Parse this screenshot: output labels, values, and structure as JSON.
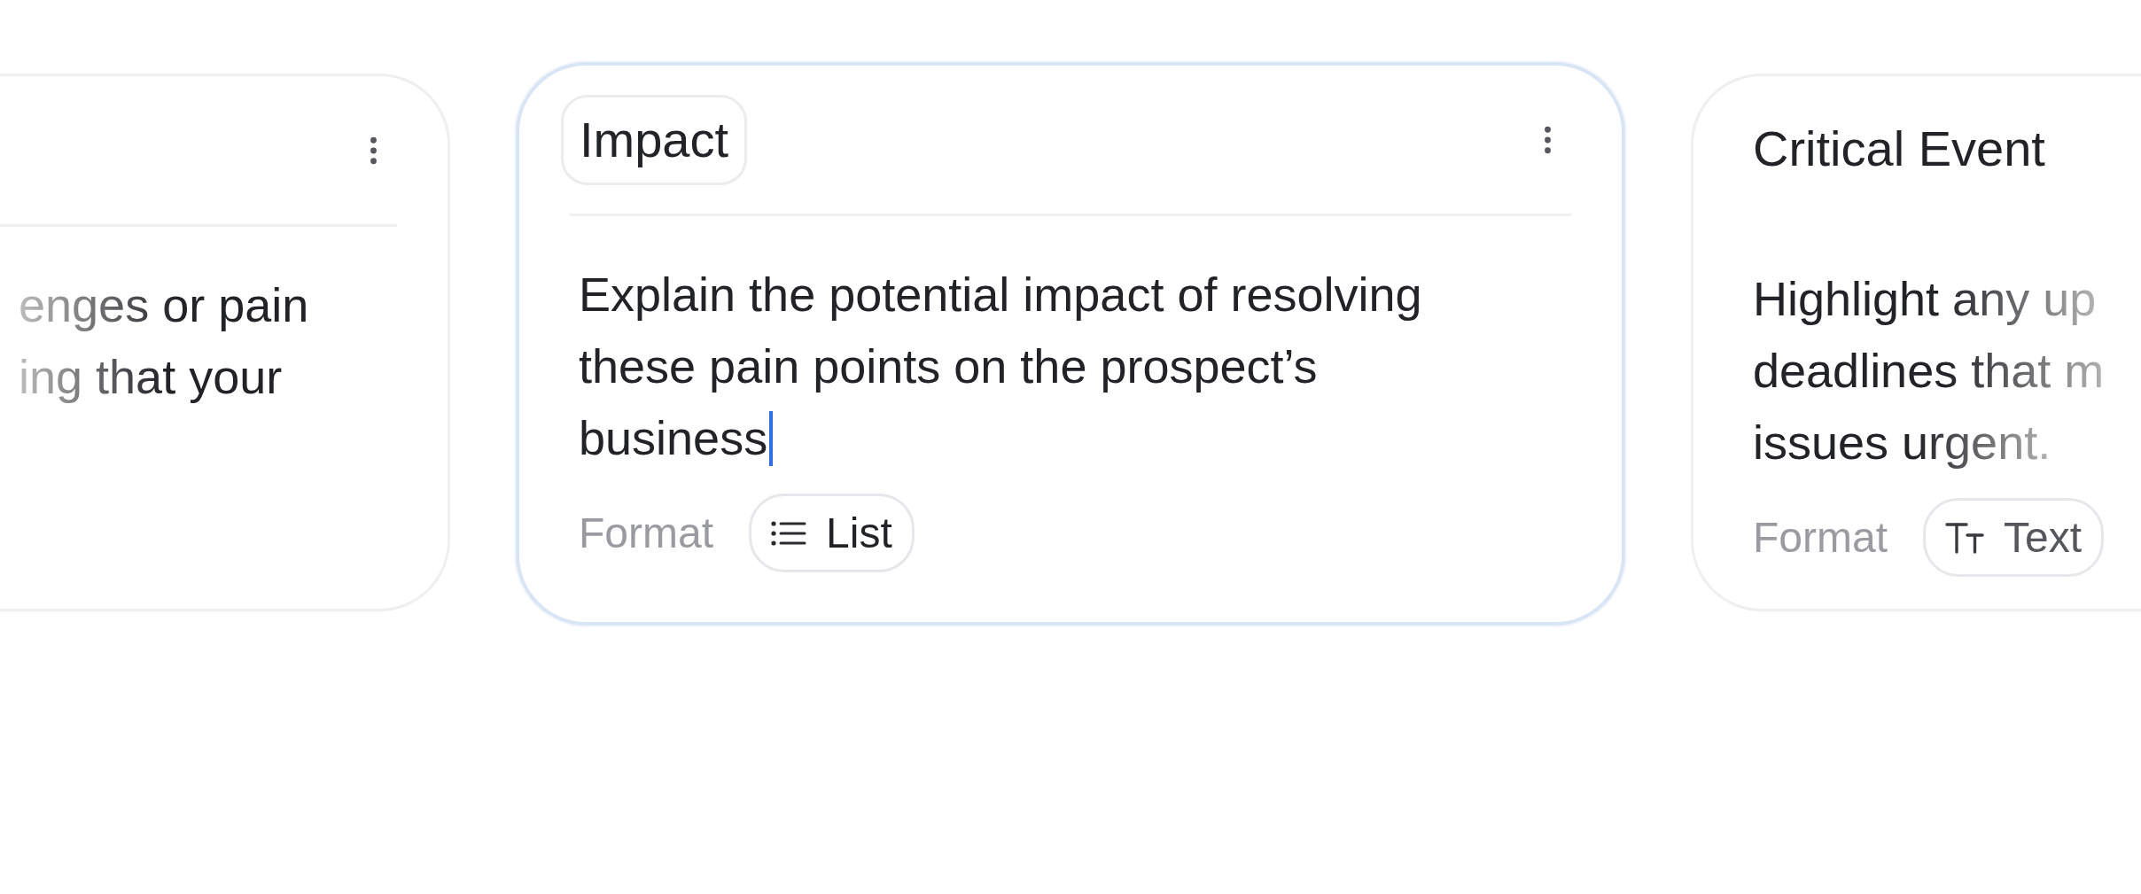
{
  "cards": [
    {
      "selected": false,
      "lines": [
        "enges or pain",
        "ing that your"
      ]
    },
    {
      "title": "Impact",
      "selected": true,
      "caret": true,
      "lines": [
        "Explain the potential impact of resolving",
        "these pain points on the prospect’s",
        "business"
      ],
      "format_label": "Format",
      "format": {
        "kind": "list",
        "label": "List"
      }
    },
    {
      "title": "Critical Event",
      "selected": false,
      "lines": [
        "Highlight any up",
        "deadlines that m",
        "issues urgent."
      ],
      "format_label": "Format",
      "format": {
        "kind": "text",
        "label": "Text"
      }
    }
  ]
}
